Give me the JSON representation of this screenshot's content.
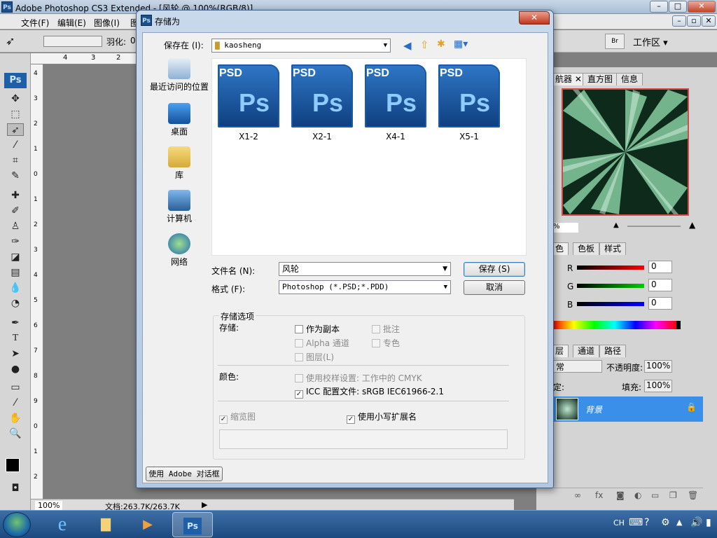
{
  "photoshop": {
    "title": "Adobe Photoshop CS3 Extended - [风轮 @ 100%(RGB/8)]",
    "menus": [
      "文件(F)",
      "编辑(E)",
      "图像(I)",
      "图"
    ],
    "options_label": "羽化:",
    "options_value": "0",
    "workspace": "工作区 ▾",
    "ruler_top": [
      "4",
      "3",
      "2"
    ],
    "ruler_left": [
      "4",
      "3",
      "2",
      "1",
      "0",
      "1",
      "2",
      "3",
      "4",
      "5",
      "6",
      "7",
      "8",
      "9",
      "0",
      "1",
      "2"
    ],
    "zoom": "100%",
    "doc_info": "文档:263.7K/263.7K"
  },
  "panels": {
    "nav_tabs": [
      "航器",
      "直方图",
      "信息"
    ],
    "nav_zoom": "%",
    "color_tabs": [
      "色",
      "色板",
      "样式"
    ],
    "channels": [
      {
        "label": "R",
        "value": "0"
      },
      {
        "label": "G",
        "value": "0"
      },
      {
        "label": "B",
        "value": "0"
      }
    ],
    "layer_tabs": [
      "层",
      "通道",
      "路径"
    ],
    "blend_mode": "常",
    "opacity_label": "不透明度:",
    "opacity_value": "100%",
    "fill_label": "填充:",
    "fill_value": "100%",
    "lock_label": "定:",
    "layer_name": "背景"
  },
  "dialog": {
    "title": "存储为",
    "save_in_label": "保存在 (I):",
    "save_in_value": "kaosheng",
    "places": [
      "最近访问的位置",
      "桌面",
      "库",
      "计算机",
      "网络"
    ],
    "files": [
      "X1-2",
      "X2-1",
      "X4-1",
      "X5-1"
    ],
    "psd_tag": "PSD",
    "ps_glyph": "Ps",
    "filename_label": "文件名 (N):",
    "filename_value": "风轮",
    "format_label": "格式 (F):",
    "format_value": "Photoshop (*.PSD;*.PDD)",
    "save_btn": "保存 (S)",
    "cancel_btn": "取消",
    "options_title": "存储选项",
    "store_label": "存储:",
    "opt_copy": "作为副本",
    "opt_notes": "批注",
    "opt_alpha": "Alpha 通道",
    "opt_spot": "专色",
    "opt_layers": "图层(L)",
    "color_label": "颜色:",
    "opt_proof": "使用校样设置: 工作中的 CMYK",
    "opt_icc": "ICC 配置文件: sRGB IEC61966-2.1",
    "opt_thumb": "缩览图",
    "opt_lower": "使用小写扩展名",
    "adobe_dialog_btn": "使用 Adobe 对话框"
  },
  "taskbar": {
    "lang": "CH",
    "ps_item": "Ps"
  }
}
